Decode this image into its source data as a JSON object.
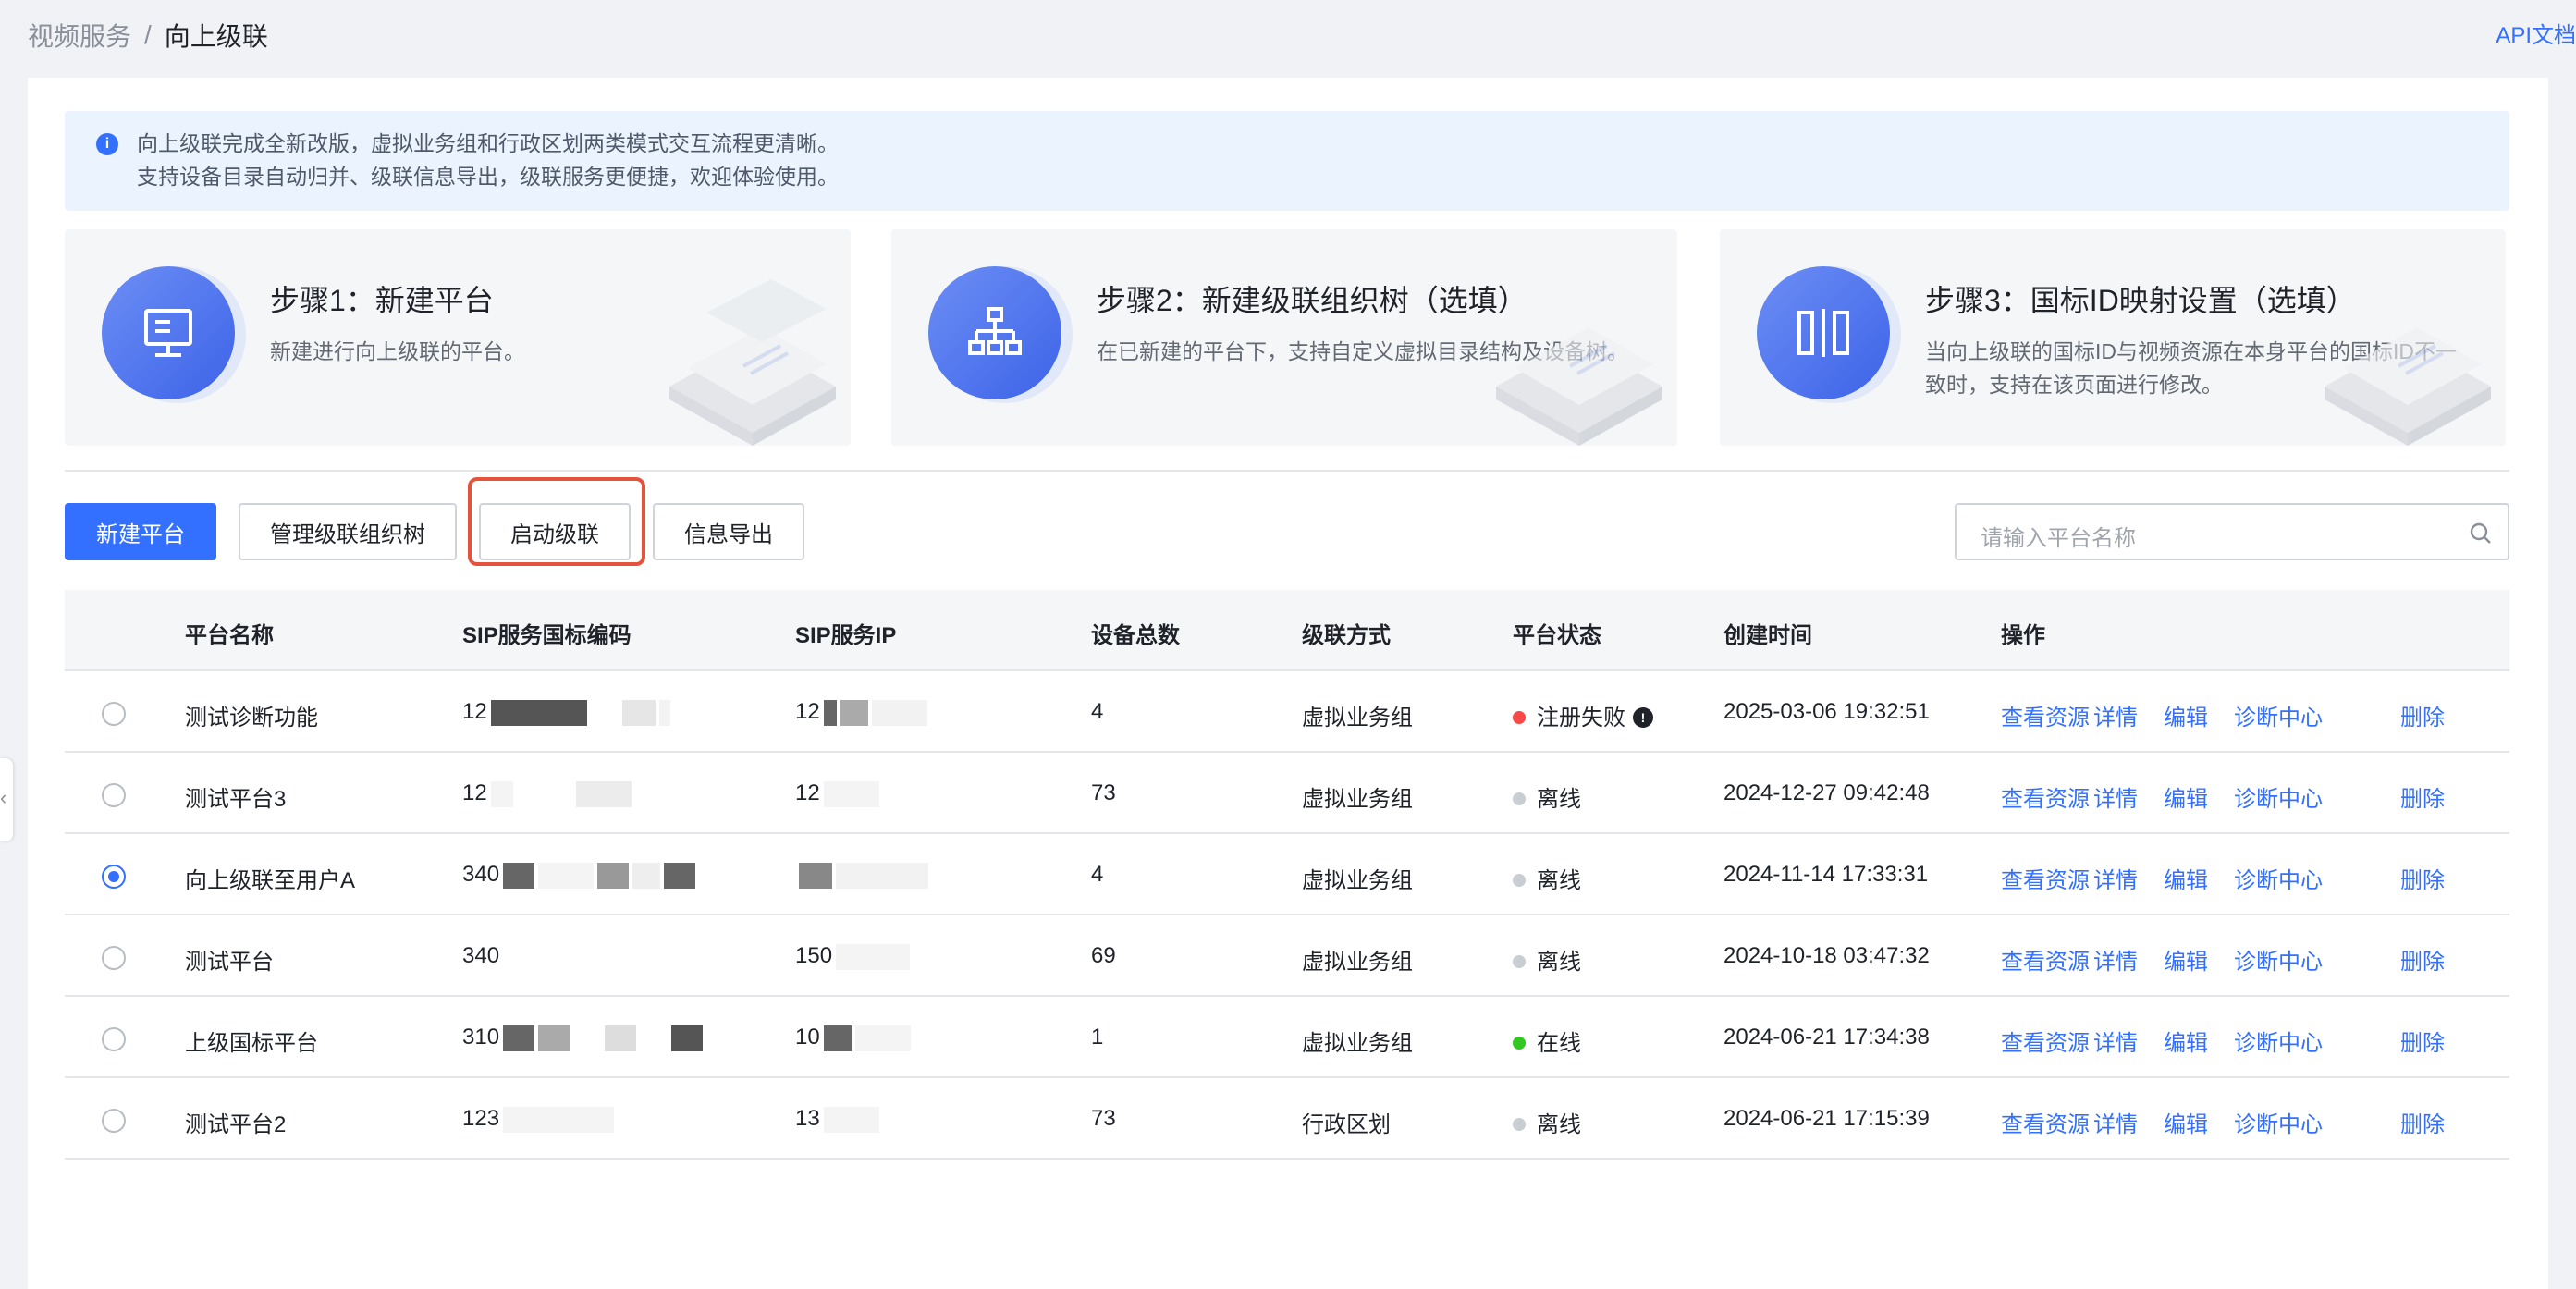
{
  "breadcrumb": {
    "parent": "视频服务",
    "separator": "/",
    "current": "向上级联"
  },
  "api_link": "API文档",
  "notice": {
    "line1": "向上级联完成全新改版，虚拟业务组和行政区划两类模式交互流程更清晰。",
    "line2": "支持设备目录自动归并、级联信息导出，级联服务更便捷，欢迎体验使用。"
  },
  "steps": [
    {
      "title": "步骤1：新建平台",
      "desc": "新建进行向上级联的平台。",
      "icon": "monitor-icon"
    },
    {
      "title": "步骤2：新建级联组织树（选填）",
      "desc": "在已新建的平台下，支持自定义虚拟目录结构及设备树。",
      "icon": "org-tree-icon"
    },
    {
      "title": "步骤3：国标ID映射设置（选填）",
      "desc": "当向上级联的国标ID与视频资源在本身平台的国标ID不一致时，支持在该页面进行修改。",
      "icon": "mapping-icon"
    }
  ],
  "toolbar": {
    "new_platform": "新建平台",
    "manage_tree": "管理级联组织树",
    "start_cascade": "启动级联",
    "export_info": "信息导出",
    "search_placeholder": "请输入平台名称"
  },
  "table": {
    "headers": [
      "平台名称",
      "SIP服务国标编码",
      "SIP服务IP",
      "设备总数",
      "级联方式",
      "平台状态",
      "创建时间",
      "操作"
    ],
    "rows": [
      {
        "selected": false,
        "name": "测试诊断功能",
        "sip_code": "12",
        "sip_ip": "12",
        "devices": "4",
        "mode": "虚拟业务组",
        "status": "注册失败",
        "status_color": "#f54a45",
        "status_info": true,
        "created": "2025-03-06 19:32:51"
      },
      {
        "selected": false,
        "name": "测试平台3",
        "sip_code": "12",
        "sip_ip": "12",
        "devices": "73",
        "mode": "虚拟业务组",
        "status": "离线",
        "status_color": "#c9cdd4",
        "status_info": false,
        "created": "2024-12-27 09:42:48"
      },
      {
        "selected": true,
        "name": "向上级联至用户A",
        "sip_code": "340",
        "sip_ip": "",
        "devices": "4",
        "mode": "虚拟业务组",
        "status": "离线",
        "status_color": "#c9cdd4",
        "status_info": false,
        "created": "2024-11-14 17:33:31"
      },
      {
        "selected": false,
        "name": "测试平台",
        "sip_code": "340",
        "sip_ip": "150",
        "devices": "69",
        "mode": "虚拟业务组",
        "status": "离线",
        "status_color": "#c9cdd4",
        "status_info": false,
        "created": "2024-10-18 03:47:32"
      },
      {
        "selected": false,
        "name": "上级国标平台",
        "sip_code": "310",
        "sip_ip": "10",
        "devices": "1",
        "mode": "虚拟业务组",
        "status": "在线",
        "status_color": "#34c724",
        "status_info": false,
        "created": "2024-06-21 17:34:38"
      },
      {
        "selected": false,
        "name": "测试平台2",
        "sip_code": "123",
        "sip_ip": "13",
        "devices": "73",
        "mode": "行政区划",
        "status": "离线",
        "status_color": "#c9cdd4",
        "status_info": false,
        "created": "2024-06-21 17:15:39"
      }
    ],
    "actions": [
      "查看资源",
      "详情",
      "编辑",
      "诊断中心",
      "删除"
    ]
  },
  "colors": {
    "primary": "#3370ff",
    "highlight_border": "#e5533d"
  }
}
